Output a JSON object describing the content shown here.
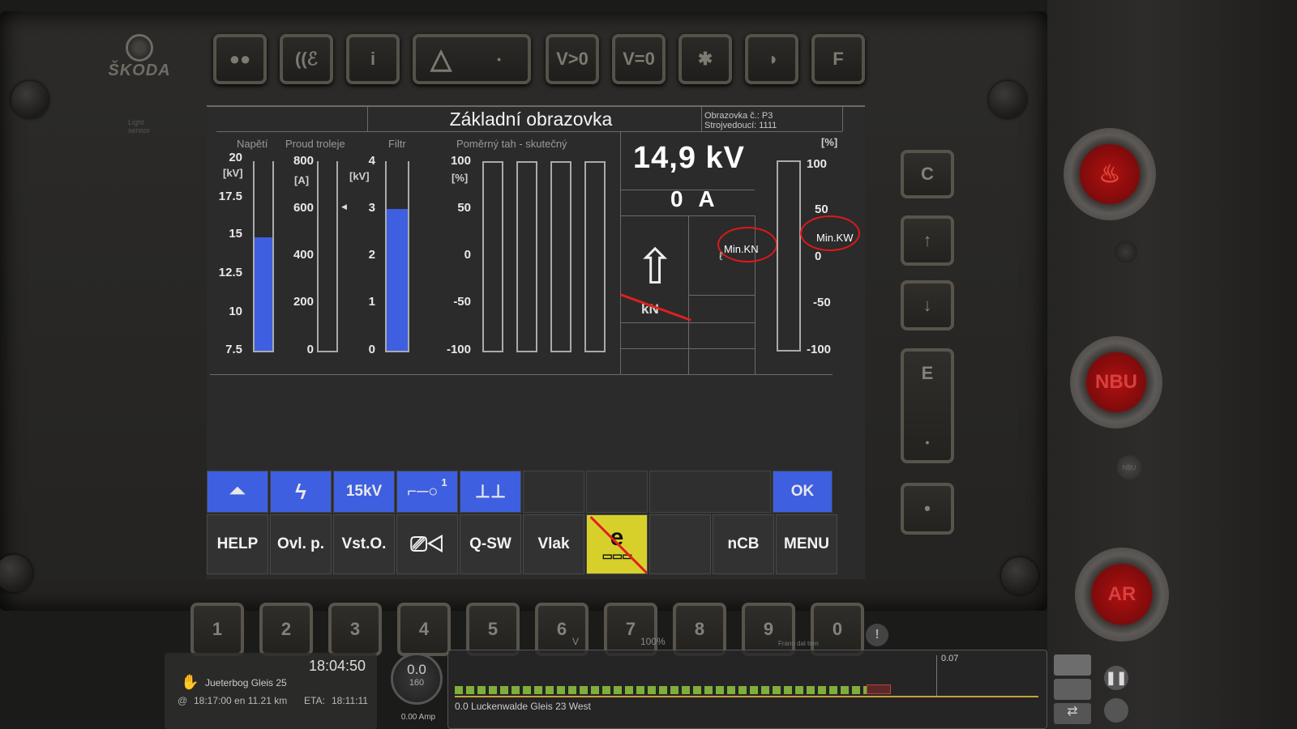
{
  "brand": {
    "logo_text": "ŠKODA",
    "light_sensor": "Light sensor"
  },
  "top_buttons": [
    {
      "label": "●●"
    },
    {
      "label": "((ℰ"
    },
    {
      "label": "i"
    },
    {
      "label": "△"
    },
    {
      "label": "V>0"
    },
    {
      "label": "V=0"
    },
    {
      "label": "✱"
    },
    {
      "label": "◑"
    },
    {
      "label": "F"
    }
  ],
  "side_buttons": [
    {
      "label": "C"
    },
    {
      "label": "↑"
    },
    {
      "label": "↓"
    },
    {
      "label": "E"
    },
    {
      "label": "•"
    }
  ],
  "number_buttons": [
    "1",
    "2",
    "3",
    "4",
    "5",
    "6",
    "7",
    "8",
    "9",
    "0"
  ],
  "red_buttons": [
    {
      "label": ""
    },
    {
      "label": "NBU"
    },
    {
      "label": "AR"
    }
  ],
  "small_nbu": "NBU",
  "screen": {
    "title": "Základní obrazovka",
    "info_line1": "Obrazovka č.: P3",
    "info_line2": "Strojvedoucí: 1111",
    "gauges": {
      "napeti": {
        "label": "Napětí",
        "unit": "[kV]",
        "ticks": [
          "20",
          "17.5",
          "15",
          "12.5",
          "10",
          "7.5"
        ],
        "value_kv": 15.0
      },
      "proud": {
        "label": "Proud troleje",
        "unit": "[A]",
        "ticks": [
          "800",
          "600",
          "400",
          "200",
          "0"
        ],
        "value_a": 0,
        "marker_a": 600
      },
      "filtr": {
        "label": "Filtr",
        "unit": "[kV]",
        "ticks": [
          "4",
          "3",
          "2",
          "1",
          "0"
        ],
        "value_kv": 3.0
      },
      "tah": {
        "label": "Poměrný tah - skutečný",
        "unit": "[%]",
        "ticks": [
          "100",
          "50",
          "0",
          "-50",
          "-100"
        ],
        "values_pct": [
          0,
          0,
          0,
          0
        ]
      },
      "right": {
        "unit": "[%]",
        "ticks": [
          "100",
          "50",
          "0",
          "-50",
          "-100"
        ],
        "value_pct": 0
      }
    },
    "voltage_readout": "14,9 kV",
    "current_readout": "0 A",
    "kn_label": "kN",
    "min_kn": "Min.KN",
    "min_kw": "Min.KW",
    "status_buttons": [
      {
        "label": ""
      },
      {
        "label": ""
      },
      {
        "label": "15kV"
      },
      {
        "label": ""
      },
      {
        "label": ""
      },
      {
        "label": ""
      },
      {
        "label": ""
      },
      {
        "label": ""
      },
      {
        "label": "OK"
      }
    ],
    "menu_buttons": [
      {
        "label": "HELP"
      },
      {
        "label": "Ovl. p."
      },
      {
        "label": "Vst.O."
      },
      {
        "label": ""
      },
      {
        "label": "Q-SW"
      },
      {
        "label": "Vlak"
      },
      {
        "label": "e"
      },
      {
        "label": ""
      },
      {
        "label": "nCB"
      },
      {
        "label": "MENU"
      }
    ]
  },
  "hud": {
    "time": "18:04:50",
    "station": "Jueterbog Gleis 25",
    "schedule": "18:17:00 en 11.21 km",
    "eta_label": "ETA:",
    "eta": "18:11:11",
    "speed": "0.0",
    "speed_limit": "160",
    "amp": "0.00 Amp",
    "track_label": "0.0 Luckenwalde Gleis 23 West",
    "track_marker": "0.07",
    "overlay_v": "V",
    "overlay_pct": "100%",
    "overlay_frano": "Frano dal tren"
  }
}
